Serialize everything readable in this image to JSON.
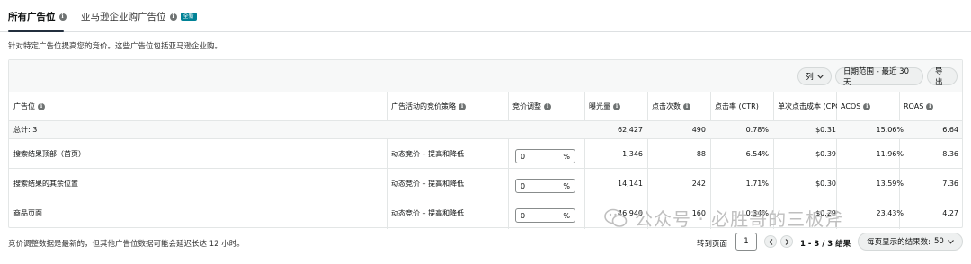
{
  "tabs": [
    {
      "label": "所有广告位",
      "active": true
    },
    {
      "label": "亚马逊企业购广告位",
      "badge": "全新"
    }
  ],
  "description": "针对特定广告位提高您的竞价。这些广告位包括亚马逊企业购。",
  "toolbar": {
    "columns_label": "列",
    "date_range_label": "日期范围 - 最近 30 天",
    "export_label": "导出"
  },
  "table": {
    "headers": {
      "placement": "广告位",
      "strategy": "广告活动的竞价策略",
      "adjustment": "竞价调整",
      "impressions": "曝光量",
      "clicks": "点击次数",
      "ctr": "点击率 (CTR)",
      "cpc": "单次点击成本 (CPC)",
      "acos": "ACOS",
      "roas": "ROAS"
    },
    "total": {
      "label": "总计: 3",
      "impressions": "62,427",
      "clicks": "490",
      "ctr": "0.78%",
      "cpc": "$0.31",
      "acos": "15.06%",
      "roas": "6.64"
    },
    "rows": [
      {
        "placement": "搜索结果顶部（首页）",
        "strategy": "动态竞价 – 提高和降低",
        "adjustment": "0",
        "unit": "%",
        "impressions": "1,346",
        "clicks": "88",
        "ctr": "6.54%",
        "cpc": "$0.39",
        "acos": "11.96%",
        "roas": "8.36"
      },
      {
        "placement": "搜索结果的其余位置",
        "strategy": "动态竞价 – 提高和降低",
        "adjustment": "0",
        "unit": "%",
        "impressions": "14,141",
        "clicks": "242",
        "ctr": "1.71%",
        "cpc": "$0.30",
        "acos": "13.59%",
        "roas": "7.36"
      },
      {
        "placement": "商品页面",
        "strategy": "动态竞价 – 提高和降低",
        "adjustment": "0",
        "unit": "%",
        "impressions": "46,940",
        "clicks": "160",
        "ctr": "0.34%",
        "cpc": "$0.29",
        "acos": "23.43%",
        "roas": "4.27"
      }
    ]
  },
  "footer": {
    "note": "竞价调整数据是最新的，但其他广告位数据可能会延迟长达 12 小时。",
    "goto_label": "转到页面",
    "page_value": "1",
    "range_text": "1 - 3 / 3 结果",
    "per_page_label": "每页显示的结果数:",
    "per_page_value": "50"
  },
  "watermark": "公众号 · 必胜哥的三板斧"
}
